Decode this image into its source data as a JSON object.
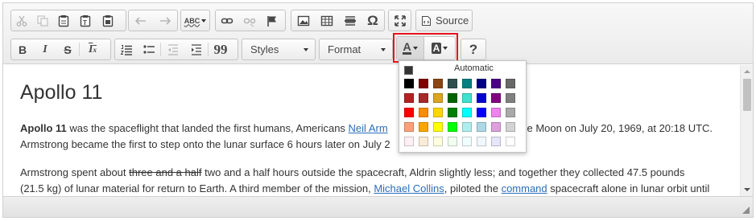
{
  "toolbar": {
    "clipboard": {
      "cut_icon": "scissors-icon",
      "copy_icon": "copy-icon",
      "paste_icon": "paste-icon",
      "paste_text_icon": "paste-text-icon",
      "paste_word_icon": "paste-word-icon"
    },
    "history": {
      "undo_icon": "undo-icon",
      "redo_icon": "redo-icon"
    },
    "spellcheck_label": "ABC",
    "links": {
      "link_icon": "link-icon",
      "unlink_icon": "unlink-icon",
      "anchor_icon": "flag-icon"
    },
    "insert": {
      "image_icon": "image-icon",
      "table_icon": "table-icon",
      "hr_icon": "horizontal-line-icon",
      "special_char_label": "Ω"
    },
    "maximize_icon": "maximize-icon",
    "source_label": "Source",
    "basic_styles": {
      "bold_label": "B",
      "italic_label": "I",
      "strike_label": "S",
      "remove_format_label": "I",
      "remove_format_sub": "x"
    },
    "lists": {
      "numbered_icon": "numbered-list-icon",
      "bulleted_icon": "bulleted-list-icon"
    },
    "indent": {
      "outdent_icon": "outdent-icon",
      "indent_icon": "indent-icon",
      "blockquote_label": "99"
    },
    "styles_combo": {
      "label": "Styles"
    },
    "format_combo": {
      "label": "Format"
    },
    "text_color_label": "A",
    "bg_color_label": "A",
    "help_label": "?"
  },
  "content": {
    "heading": "Apollo 11",
    "p1": {
      "bold": "Apollo 11",
      "text1": " was the spaceflight that landed the first humans, Americans ",
      "link1": "Neil Arm",
      "text2": "the Moon on July 20, 1969, at 20:18 UTC.",
      "line2": "Armstrong became the first to step onto the lunar surface 6 hours later on July 2"
    },
    "p2": {
      "text1": "Armstrong spent about ",
      "strike": "three and a half",
      "text2": " two and a half hours outside the spacecraft, Aldrin slightly less; and together they collected 47.5 pounds",
      "line2a": "(21.5 kg) of lunar material for return to Earth. A third member of the mission, ",
      "link2": "Michael Collins",
      "line2b": ", piloted the ",
      "link3": "command",
      "line2c": " spacecraft alone in lunar orbit until"
    }
  },
  "color_panel": {
    "automatic_label": "Automatic",
    "automatic_color": "#333333",
    "colors": [
      "#000000",
      "#800000",
      "#8b4513",
      "#2f4f4f",
      "#008080",
      "#000080",
      "#4b0082",
      "#696969",
      "#b22222",
      "#a52a2a",
      "#daa520",
      "#006400",
      "#40e0d0",
      "#0000cd",
      "#800080",
      "#808080",
      "#ff0000",
      "#ff8c00",
      "#ffd700",
      "#008000",
      "#00ffff",
      "#0000ff",
      "#ee82ee",
      "#a9a9a9",
      "#ffa07a",
      "#ffa500",
      "#ffff00",
      "#00ff00",
      "#afeeee",
      "#add8e6",
      "#dda0dd",
      "#d3d3d3",
      "#fff0f5",
      "#faebd7",
      "#ffffe0",
      "#f0fff0",
      "#f0ffff",
      "#f0f8ff",
      "#e6e6fa",
      "#ffffff"
    ]
  },
  "accent": {
    "highlight_border": "#e2161c",
    "link_color": "#2a6ebb"
  }
}
